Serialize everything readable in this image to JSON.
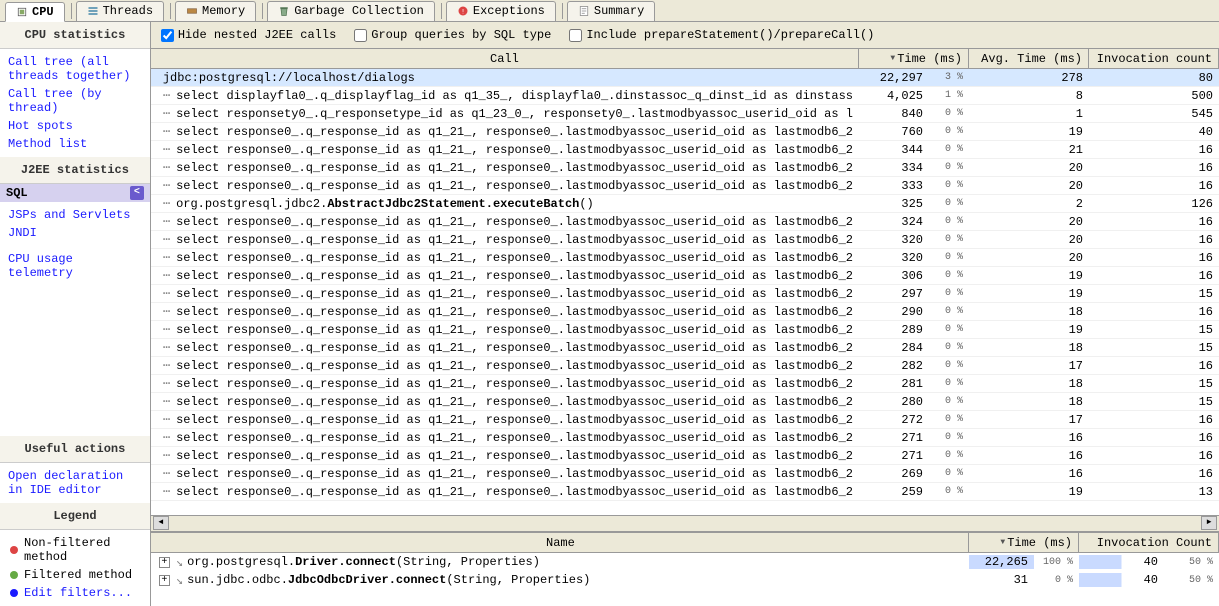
{
  "tabs": [
    {
      "label": "CPU",
      "active": true,
      "icon": "cpu"
    },
    {
      "label": "Threads",
      "active": false,
      "icon": "threads"
    },
    {
      "label": "Memory",
      "active": false,
      "icon": "memory"
    },
    {
      "label": "Garbage Collection",
      "active": false,
      "icon": "trash"
    },
    {
      "label": "Exceptions",
      "active": false,
      "icon": "exception"
    },
    {
      "label": "Summary",
      "active": false,
      "icon": "summary"
    }
  ],
  "sidebar": {
    "section1_title": "CPU statistics",
    "section1_links": [
      "Call tree (all threads together)",
      "Call tree (by thread)",
      "Hot spots",
      "Method list"
    ],
    "section2_title": "J2EE statistics",
    "selected": "SQL",
    "section2_links": [
      "JSPs and Servlets",
      "JNDI"
    ],
    "telemetry": "CPU usage telemetry",
    "useful_title": "Useful actions",
    "useful_link": "Open declaration in IDE editor",
    "legend_title": "Legend",
    "legend_items": [
      "Non-filtered method",
      "Filtered method",
      "Edit filters..."
    ]
  },
  "toolbar": {
    "hide_nested": "Hide nested J2EE calls",
    "group_queries": "Group queries by SQL type",
    "include_prepare": "Include prepareStatement()/prepareCall()"
  },
  "table": {
    "h_call": "Call",
    "h_time": "Time (ms)",
    "h_avg": "Avg. Time (ms)",
    "h_inv": "Invocation count",
    "rows": [
      {
        "call": "jdbc:postgresql://localhost/dialogs",
        "time": "22,297",
        "pct": "3 %",
        "avg": "278",
        "inv": "80",
        "first": true
      },
      {
        "call": "select displayfla0_.q_displayflag_id as q1_35_, displayfla0_.dinstassoc_q_dinst_id as dinstass",
        "time": "4,025",
        "pct": "1 %",
        "avg": "8",
        "inv": "500"
      },
      {
        "call": "select responsety0_.q_responsetype_id as q1_23_0_, responsety0_.lastmodbyassoc_userid_oid as l",
        "time": "840",
        "pct": "0 %",
        "avg": "1",
        "inv": "545"
      },
      {
        "call": "select response0_.q_response_id as q1_21_, response0_.lastmodbyassoc_userid_oid as lastmodb6_2",
        "time": "760",
        "pct": "0 %",
        "avg": "19",
        "inv": "40"
      },
      {
        "call": "select response0_.q_response_id as q1_21_, response0_.lastmodbyassoc_userid_oid as lastmodb6_2",
        "time": "344",
        "pct": "0 %",
        "avg": "21",
        "inv": "16"
      },
      {
        "call": "select response0_.q_response_id as q1_21_, response0_.lastmodbyassoc_userid_oid as lastmodb6_2",
        "time": "334",
        "pct": "0 %",
        "avg": "20",
        "inv": "16"
      },
      {
        "call": "select response0_.q_response_id as q1_21_, response0_.lastmodbyassoc_userid_oid as lastmodb6_2",
        "time": "333",
        "pct": "0 %",
        "avg": "20",
        "inv": "16"
      },
      {
        "call_pre": "org.postgresql.jdbc2.",
        "call_bold": "AbstractJdbc2Statement.executeBatch",
        "call_post": "()",
        "time": "325",
        "pct": "0 %",
        "avg": "2",
        "inv": "126",
        "compound": true
      },
      {
        "call": "select response0_.q_response_id as q1_21_, response0_.lastmodbyassoc_userid_oid as lastmodb6_2",
        "time": "324",
        "pct": "0 %",
        "avg": "20",
        "inv": "16"
      },
      {
        "call": "select response0_.q_response_id as q1_21_, response0_.lastmodbyassoc_userid_oid as lastmodb6_2",
        "time": "320",
        "pct": "0 %",
        "avg": "20",
        "inv": "16"
      },
      {
        "call": "select response0_.q_response_id as q1_21_, response0_.lastmodbyassoc_userid_oid as lastmodb6_2",
        "time": "320",
        "pct": "0 %",
        "avg": "20",
        "inv": "16"
      },
      {
        "call": "select response0_.q_response_id as q1_21_, response0_.lastmodbyassoc_userid_oid as lastmodb6_2",
        "time": "306",
        "pct": "0 %",
        "avg": "19",
        "inv": "16"
      },
      {
        "call": "select response0_.q_response_id as q1_21_, response0_.lastmodbyassoc_userid_oid as lastmodb6_2",
        "time": "297",
        "pct": "0 %",
        "avg": "19",
        "inv": "15"
      },
      {
        "call": "select response0_.q_response_id as q1_21_, response0_.lastmodbyassoc_userid_oid as lastmodb6_2",
        "time": "290",
        "pct": "0 %",
        "avg": "18",
        "inv": "16"
      },
      {
        "call": "select response0_.q_response_id as q1_21_, response0_.lastmodbyassoc_userid_oid as lastmodb6_2",
        "time": "289",
        "pct": "0 %",
        "avg": "19",
        "inv": "15"
      },
      {
        "call": "select response0_.q_response_id as q1_21_, response0_.lastmodbyassoc_userid_oid as lastmodb6_2",
        "time": "284",
        "pct": "0 %",
        "avg": "18",
        "inv": "15"
      },
      {
        "call": "select response0_.q_response_id as q1_21_, response0_.lastmodbyassoc_userid_oid as lastmodb6_2",
        "time": "282",
        "pct": "0 %",
        "avg": "17",
        "inv": "16"
      },
      {
        "call": "select response0_.q_response_id as q1_21_, response0_.lastmodbyassoc_userid_oid as lastmodb6_2",
        "time": "281",
        "pct": "0 %",
        "avg": "18",
        "inv": "15"
      },
      {
        "call": "select response0_.q_response_id as q1_21_, response0_.lastmodbyassoc_userid_oid as lastmodb6_2",
        "time": "280",
        "pct": "0 %",
        "avg": "18",
        "inv": "15"
      },
      {
        "call": "select response0_.q_response_id as q1_21_, response0_.lastmodbyassoc_userid_oid as lastmodb6_2",
        "time": "272",
        "pct": "0 %",
        "avg": "17",
        "inv": "16"
      },
      {
        "call": "select response0_.q_response_id as q1_21_, response0_.lastmodbyassoc_userid_oid as lastmodb6_2",
        "time": "271",
        "pct": "0 %",
        "avg": "16",
        "inv": "16"
      },
      {
        "call": "select response0_.q_response_id as q1_21_, response0_.lastmodbyassoc_userid_oid as lastmodb6_2",
        "time": "271",
        "pct": "0 %",
        "avg": "16",
        "inv": "16"
      },
      {
        "call": "select response0_.q_response_id as q1_21_, response0_.lastmodbyassoc_userid_oid as lastmodb6_2",
        "time": "269",
        "pct": "0 %",
        "avg": "16",
        "inv": "16"
      },
      {
        "call": "select response0_.q_response_id as q1_21_, response0_.lastmodbyassoc_userid_oid as lastmodb6_2",
        "time": "259",
        "pct": "0 %",
        "avg": "19",
        "inv": "13"
      }
    ]
  },
  "lower": {
    "h_name": "Name",
    "h_time": "Time (ms)",
    "h_inv": "Invocation Count",
    "rows": [
      {
        "pre": "org.postgresql.",
        "bold": "Driver.connect",
        "post": "(String, Properties)",
        "time": "22,265",
        "timepct": "100 %",
        "inv": "40",
        "invpct": "50 %"
      },
      {
        "pre": "sun.jdbc.odbc.",
        "bold": "JdbcOdbcDriver.connect",
        "post": "(String, Properties)",
        "time": "31",
        "timepct": "0 %",
        "inv": "40",
        "invpct": "50 %"
      }
    ]
  }
}
